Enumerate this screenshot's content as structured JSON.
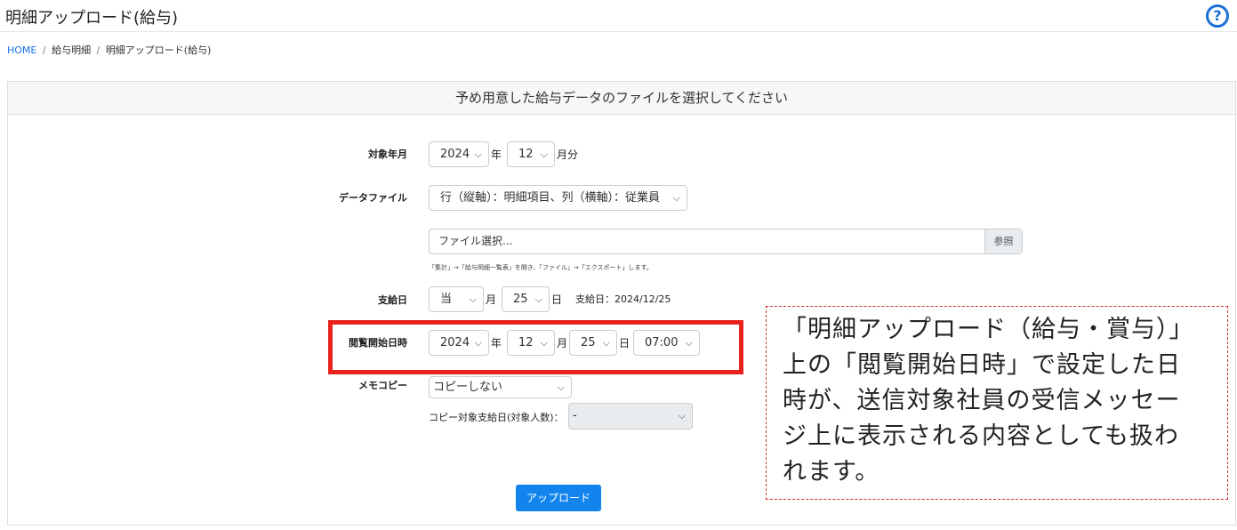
{
  "header": {
    "title": "明細アップロード(給与)",
    "help_icon_glyph": "?"
  },
  "breadcrumb": {
    "home": "HOME",
    "separator": "/",
    "level1": "給与明細",
    "level2": "明細アップロード(給与)"
  },
  "card": {
    "header": "予め用意した給与データのファイルを選択してください"
  },
  "form": {
    "target_month": {
      "label": "対象年月",
      "year": "2024",
      "year_unit": "年",
      "month": "12",
      "month_unit": "月分"
    },
    "data_file": {
      "label": "データファイル",
      "format": "行（縦軸）：明細項目、列（横軸）：従業員",
      "file_placeholder": "ファイル選択...",
      "browse_label": "参照",
      "hint": "「集計」→「給与明細一覧表」を開き、「ファイル」→「エクスポート」します。"
    },
    "pay_date": {
      "label": "支給日",
      "month": "当",
      "month_unit": "月",
      "day": "25",
      "day_unit": "日",
      "display": "支給日：2024/12/25"
    },
    "view_start": {
      "label": "閲覧開始日時",
      "year": "2024",
      "year_unit": "年",
      "month": "12",
      "month_unit": "月",
      "day": "25",
      "day_unit": "日",
      "time": "07:00"
    },
    "memo_copy": {
      "label": "メモコピー",
      "value": "コピーしない",
      "target_label": "コピー対象支給日(対象人数)：",
      "target_value": "-"
    },
    "upload_label": "アップロード"
  },
  "callout": {
    "text": "「明細アップロード（給与・賞与）」上の「閲覧開始日時」で設定した日時が、送信対象社員の受信メッセージ上に表示される内容としても扱われます。"
  },
  "colors": {
    "accent": "#1384ee",
    "highlight": "#e8221c"
  }
}
